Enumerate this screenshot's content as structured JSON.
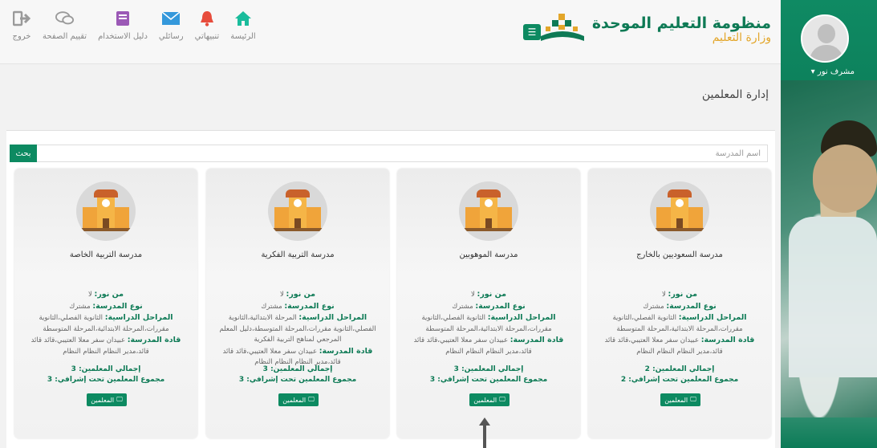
{
  "header": {
    "logo_title": "منظومة التعليم الموحدة",
    "logo_subtitle": "وزارة التعليم",
    "nav": [
      {
        "label": "خروج",
        "icon": "logout-icon",
        "color": "#9a9a9a"
      },
      {
        "label": "تقييم الصفحة",
        "icon": "chat-icon",
        "color": "#9a9a9a"
      },
      {
        "label": "دليل الاستخدام",
        "icon": "book-icon",
        "color": "#9b59b6"
      },
      {
        "label": "رسائلي",
        "icon": "mail-icon",
        "color": "#3498db"
      },
      {
        "label": "تنبيهاتي",
        "icon": "bell-icon",
        "color": "#e74c3c"
      },
      {
        "label": "الرئيسة",
        "icon": "home-icon",
        "color": "#1abc9c"
      }
    ]
  },
  "user": {
    "name": "مشرف نور ▾"
  },
  "page": {
    "title": "إدارة المعلمين"
  },
  "search": {
    "placeholder": "اسم المدرسة",
    "button": "بحث"
  },
  "labels": {
    "from_noor": "من نور:",
    "school_type": "نوع المدرسة:",
    "stages": "المراحل الدراسية:",
    "leaders": "قادة المدرسة:",
    "total_teachers": "إجمالي المعلمين:",
    "supervised": "مجموع المعلمين تحت إشرافي:",
    "teachers_btn": "المعلمين"
  },
  "cards": [
    {
      "name": "مدرسة السعوديين بالخارج",
      "from_noor": "لا",
      "school_type": "مشترك",
      "stages": "الثانوية الفصلي،الثانوية مقررات،المرحلة الابتدائية،المرحلة المتوسطة",
      "leaders": "عبيدان سفر معلا العتيبي،قائد قائد قائد،مدير النظام النظام النظام",
      "total_teachers": "2",
      "supervised": "2"
    },
    {
      "name": "مدرسة الموهوبين",
      "from_noor": "لا",
      "school_type": "مشترك",
      "stages": "الثانوية الفصلي،الثانوية مقررات،المرحلة الابتدائية،المرحلة المتوسطة",
      "leaders": "عبيدان سفر معلا العتيبي،قائد قائد قائد،مدير النظام النظام النظام",
      "total_teachers": "3",
      "supervised": "3"
    },
    {
      "name": "مدرسة التربية الفكرية",
      "from_noor": "لا",
      "school_type": "مشترك",
      "stages": "المرحلة الابتدائية،الثانوية الفصلي،الثانوية مقررات،المرحلة المتوسطة،دليل المعلم المرجعي لمناهج التربية الفكرية",
      "leaders": "عبيدان سفر معلا العتيبي،قائد قائد قائد،مدير النظام النظام النظام",
      "total_teachers": "3",
      "supervised": "3"
    },
    {
      "name": "مدرسة التربية الخاصة",
      "from_noor": "لا",
      "school_type": "مشترك",
      "stages": "الثانوية الفصلي،الثانوية مقررات،المرحلة الابتدائية،المرحلة المتوسطة",
      "leaders": "عبيدان سفر معلا العتيبي،قائد قائد قائد،مدير النظام النظام النظام",
      "total_teachers": "3",
      "supervised": "3"
    }
  ]
}
